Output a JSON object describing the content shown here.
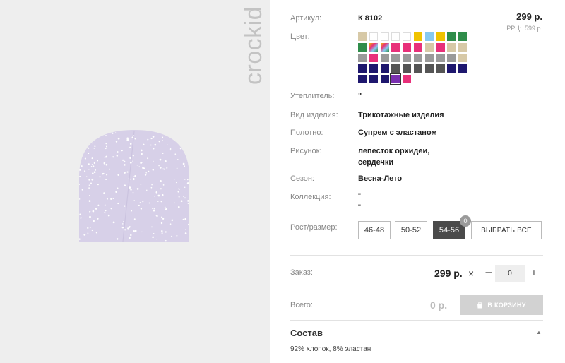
{
  "brand": "crockid",
  "product": {
    "article_label": "Артикул:",
    "article": "К 8102",
    "price": "299 р.",
    "rrp_label": "РРЦ:",
    "rrp_value": "599 р.",
    "color_label": "Цвет:",
    "swatch_colors": [
      [
        "#d7c9a7",
        "#ffffff",
        "#ffffff",
        "#ffffff",
        "#ffffff",
        "#f0c300",
        "#86c9f0",
        "#f0c300",
        "#2f8d4a",
        "#2f8d4a"
      ],
      [
        "#2f8d4a",
        "#rainbow",
        "#rainbow",
        "#e8307a",
        "#e8307a",
        "#e8307a",
        "#d7c9a7",
        "#e8307a",
        "#d7c9a7",
        "#d7c9a7"
      ],
      [
        "#9a9a9a",
        "#e8307a",
        "#9a9a9a",
        "#9a9a9a",
        "#9a9a9a",
        "#9a9a9a",
        "#9a9a9a",
        "#9a9a9a",
        "#9a9a9a",
        "#d7c9a7"
      ],
      [
        "#1e176e",
        "#1e176e",
        "#1e176e",
        "#555555",
        "#555555",
        "#555555",
        "#555555",
        "#555555",
        "#1e176e",
        "#1e176e"
      ],
      [
        "#1e176e",
        "#1e176e",
        "#1e176e",
        "#7a2fb0",
        "#e8307a"
      ]
    ],
    "specs": [
      {
        "label": "Утеплитель:",
        "value": "\""
      },
      {
        "label": "Вид изделия:",
        "value": "Трикотажные изделия"
      },
      {
        "label": "Полотно:",
        "value": "Супрем с эластаном"
      },
      {
        "label": "Рисунок:",
        "value": "лепесток орхидеи,\nсердечки"
      },
      {
        "label": "Сезон:",
        "value": "Весна-Лето"
      },
      {
        "label": "Коллекция:",
        "value": "\"\n\""
      }
    ],
    "size_label": "Рост/размер:",
    "sizes": [
      "46-48",
      "50-52",
      "54-56"
    ],
    "active_size": "54-56",
    "size_badge": "0",
    "select_all": "ВЫБРАТЬ ВСЕ",
    "order_label": "Заказ:",
    "order_price": "299 р.",
    "times": "×",
    "minus": "–",
    "plus": "+",
    "quantity": "0",
    "total_label": "Всего:",
    "total_value": "0 р.",
    "cart_button": "В КОРЗИНУ",
    "composition_title": "Состав",
    "composition_chevron": "▲",
    "composition_text": "92% хлопок, 8% эластан"
  }
}
